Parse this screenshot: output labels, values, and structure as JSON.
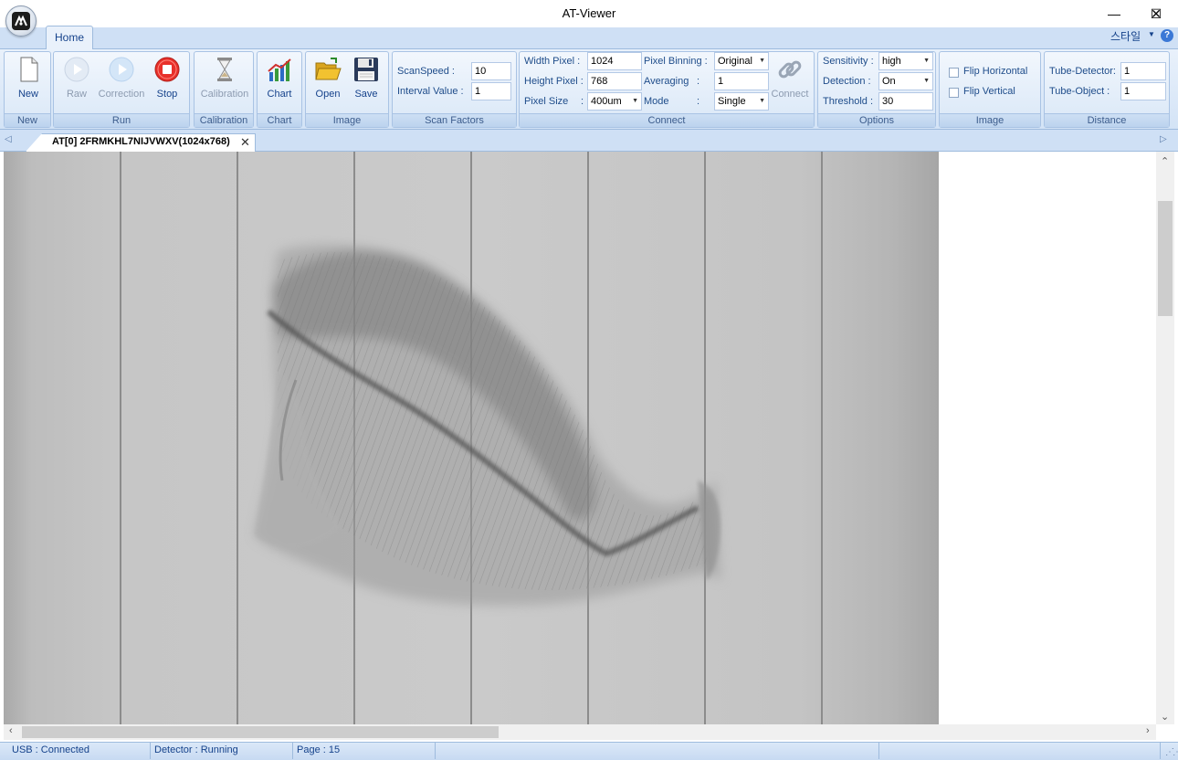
{
  "window": {
    "title": "AT-Viewer",
    "minimize_glyph": "—",
    "maximize_glyph": "☐",
    "close_glyph": "✕"
  },
  "ribbon_tabs": {
    "home": "Home",
    "style_menu": "스타일",
    "help_glyph": "?"
  },
  "groups": {
    "new": {
      "label": "New",
      "buttons": {
        "new": "New"
      }
    },
    "run": {
      "label": "Run",
      "buttons": {
        "raw": "Raw",
        "correction": "Correction",
        "stop": "Stop"
      }
    },
    "calibration": {
      "label": "Calibration",
      "buttons": {
        "calibration": "Calibration"
      }
    },
    "chart": {
      "label": "Chart",
      "buttons": {
        "chart": "Chart"
      }
    },
    "image": {
      "label": "Image",
      "buttons": {
        "open": "Open",
        "save": "Save"
      }
    },
    "scan_factors": {
      "label": "Scan Factors",
      "scan_speed_label": "ScanSpeed  :",
      "scan_speed_value": "10",
      "interval_label": "Interval Value  :",
      "interval_value": "1"
    },
    "connect": {
      "label": "Connect",
      "width_label": "Width Pixel :",
      "width_value": "1024",
      "height_label": "Height Pixel :",
      "height_value": "768",
      "pixel_size_label": "Pixel Size",
      "pixel_size_colon": ":",
      "pixel_size_value": "400um",
      "binning_label": "Pixel Binning :",
      "binning_value": "Original",
      "averaging_label": "Averaging",
      "averaging_colon": ":",
      "averaging_value": "1",
      "mode_label": "Mode",
      "mode_colon": ":",
      "mode_value": "Single",
      "connect_button": "Connect"
    },
    "options": {
      "label": "Options",
      "sensitivity_label": "Sensitivity :",
      "sensitivity_value": "high",
      "detection_label": "Detection :",
      "detection_value": "On",
      "threshold_label": "Threshold :",
      "threshold_value": "30"
    },
    "flip": {
      "label": "Image",
      "flip_horizontal": "Flip Horizontal",
      "flip_vertical": "Flip Vertical",
      "flip_horizontal_checked": false,
      "flip_vertical_checked": false
    },
    "distance": {
      "label": "Distance",
      "tube_detector_label": "Tube-Detector:",
      "tube_detector_value": "1",
      "tube_object_label": "Tube-Object :",
      "tube_object_value": "1"
    }
  },
  "document_tab": {
    "label": "AT[0]  2FRMKHL7NIJVWXV(1024x768)",
    "close_glyph": "✕"
  },
  "status": {
    "usb": "USB : Connected",
    "detector": "Detector : Running",
    "page": "Page : 15"
  },
  "colors": {
    "ribbon_bg": "#d3e3f6",
    "stop_red": "#e8302a",
    "chart_blue": "#2b6cc4",
    "folder_yellow": "#f2c230"
  },
  "icons": {
    "new": "new-document-icon",
    "raw": "play-icon",
    "correction": "play-icon",
    "stop": "stop-icon",
    "calibration": "hourglass-icon",
    "chart": "chart-icon",
    "open": "folder-open-icon",
    "save": "floppy-disk-icon",
    "connect": "chain-link-icon"
  }
}
